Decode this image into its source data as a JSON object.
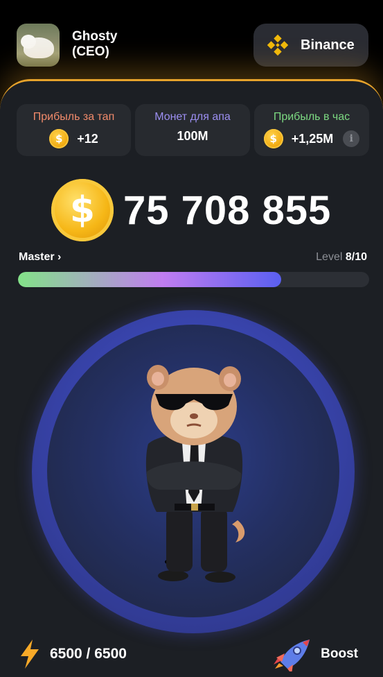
{
  "user": {
    "name": "Ghosty (CEO)"
  },
  "exchange": {
    "label": "Binance",
    "brand_color": "#F0B90B"
  },
  "stats": [
    {
      "title": "Прибыль за тап",
      "value": "+12",
      "title_color": "#F28B6B"
    },
    {
      "title": "Монет для апа",
      "value": "100M",
      "title_color": "#9C8FF2"
    },
    {
      "title": "Прибыль в час",
      "value": "+1,25M",
      "title_color": "#7DDA82"
    }
  ],
  "balance": {
    "value": "75 708 855"
  },
  "rank": {
    "label": "Master",
    "chevron": "›"
  },
  "level": {
    "prefix": "Level",
    "value": "8/10",
    "progress_fraction": 0.75
  },
  "energy": {
    "text": "6500 / 6500"
  },
  "boost": {
    "label": "Boost"
  },
  "icons": {
    "coin": "dollar-coin-icon",
    "info": "info-icon",
    "energy": "lightning-icon",
    "boost": "rocket-icon",
    "exchange": "binance-logo-icon"
  },
  "colors": {
    "accent_gold": "#E7A32B",
    "panel_bg": "#1C1F24",
    "card_bg": "#272A2F"
  }
}
